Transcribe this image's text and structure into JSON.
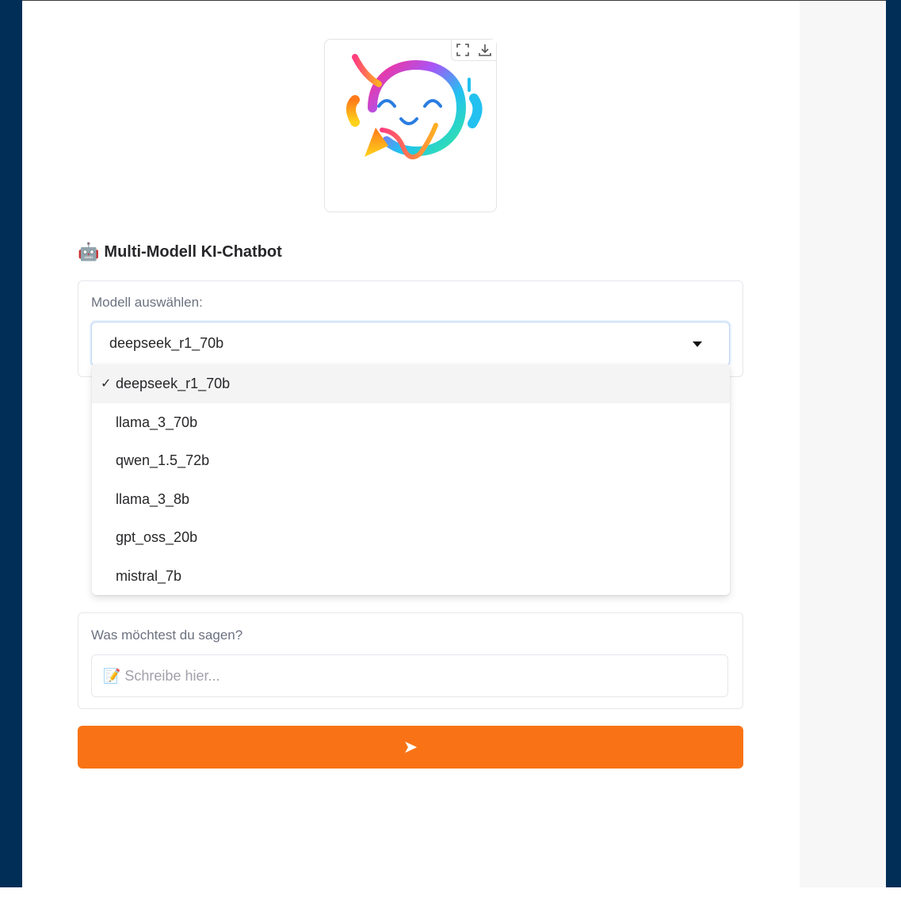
{
  "title": {
    "emoji": "🤖",
    "text": "Multi-Modell KI-Chatbot"
  },
  "logo": {
    "name": "chatbot-logo"
  },
  "model_select": {
    "label": "Modell auswählen:",
    "value": "deepseek_r1_70b",
    "options": [
      {
        "label": "deepseek_r1_70b",
        "selected": true
      },
      {
        "label": "llama_3_70b",
        "selected": false
      },
      {
        "label": "qwen_1.5_72b",
        "selected": false
      },
      {
        "label": "llama_3_8b",
        "selected": false
      },
      {
        "label": "gpt_oss_20b",
        "selected": false
      },
      {
        "label": "mistral_7b",
        "selected": false
      }
    ],
    "check_mark": "✓"
  },
  "message": {
    "label": "Was möchtest du sagen?",
    "placeholder": "📝 Schreibe hier...",
    "value": ""
  },
  "send_button": {
    "label": "➤"
  },
  "colors": {
    "accent": "#f97316",
    "sidebar_bg": "#002e57"
  }
}
